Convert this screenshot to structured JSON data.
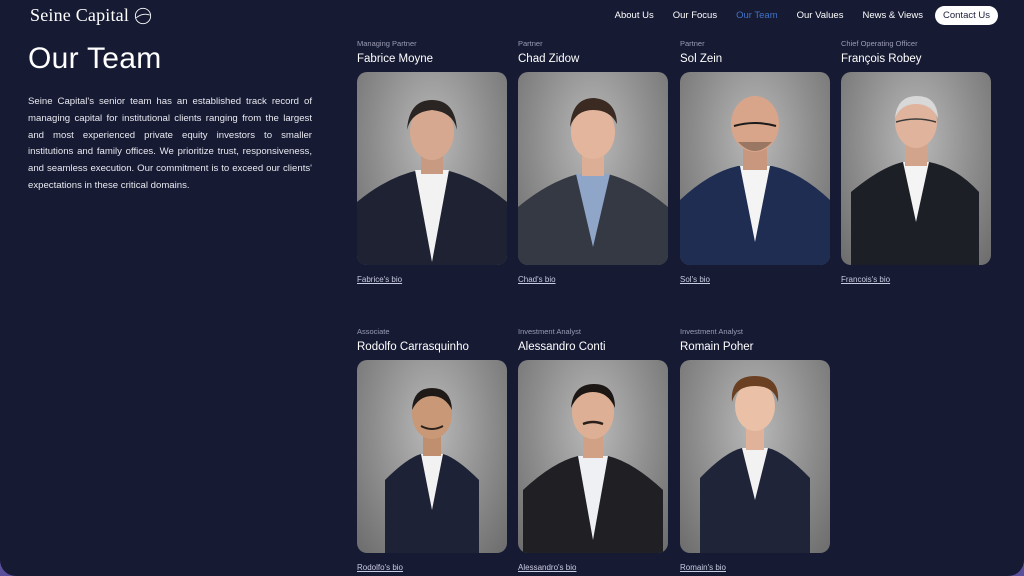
{
  "brand": {
    "name": "Seine Capital"
  },
  "nav": {
    "items": [
      {
        "label": "About Us",
        "active": false
      },
      {
        "label": "Our Focus",
        "active": false
      },
      {
        "label": "Our Team",
        "active": true
      },
      {
        "label": "Our Values",
        "active": false
      },
      {
        "label": "News & Views",
        "active": false
      }
    ],
    "contact_label": "Contact Us",
    "active_color": "#3f73c8"
  },
  "intro": {
    "title": "Our Team",
    "text": "Seine Capital's senior team has an established track record of managing capital for institutional clients ranging from the largest and most experienced private equity investors to smaller institutions and family offices. We prioritize trust, responsiveness, and seamless execution. Our commitment is to exceed our clients' expectations in these critical domains."
  },
  "team": [
    {
      "role": "Managing Partner",
      "name": "Fabrice Moyne",
      "bio_label": "Fabrice's bio"
    },
    {
      "role": "Partner",
      "name": "Chad Zidow",
      "bio_label": "Chad's bio"
    },
    {
      "role": "Partner",
      "name": "Sol Zein",
      "bio_label": "Sol's bio"
    },
    {
      "role": "Chief Operating Officer",
      "name": "François Robey",
      "bio_label": "Francois's bio"
    },
    {
      "role": "Associate",
      "name": "Rodolfo Carrasquinho",
      "bio_label": "Rodolfo's bio"
    },
    {
      "role": "Investment Analyst",
      "name": "Alessandro Conti",
      "bio_label": "Alessandro's bio"
    },
    {
      "role": "Investment Analyst",
      "name": "Romain Poher",
      "bio_label": "Romain's bio"
    }
  ],
  "colors": {
    "background": "#161a33",
    "accent": "#3f73c8",
    "suit_dark": "#1f2232",
    "suit_navy": "#1f2d52",
    "suit_grey": "#353943"
  }
}
